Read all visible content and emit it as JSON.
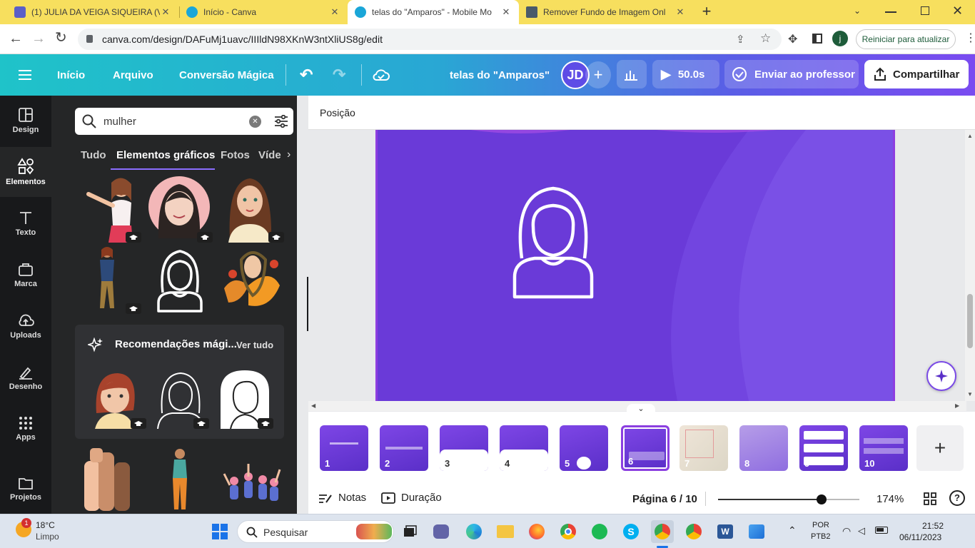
{
  "browser": {
    "tabs": [
      {
        "title": "(1) JULIA DA VEIGA SIQUEIRA (V",
        "icon": "teams-icon"
      },
      {
        "title": "Início - Canva",
        "icon": "canva-icon"
      },
      {
        "title": "telas do \"Amparos\" - Mobile Mo",
        "icon": "canva-icon",
        "active": true
      },
      {
        "title": "Remover Fundo de Imagem Onl",
        "icon": "remove-bg-icon"
      }
    ],
    "url": "canva.com/design/DAFuMj1uavc/IIIldN98XKnW3ntXliUS8g/edit",
    "profile_initial": "j",
    "update_button": "Reiniciar para atualizar"
  },
  "header": {
    "menu_items": [
      "Início",
      "Arquivo",
      "Conversão Mágica"
    ],
    "title": "telas do \"Amparos\"",
    "avatar": "JD",
    "play_time": "50.0s",
    "send_label": "Enviar ao professor",
    "share_label": "Compartilhar"
  },
  "rail": [
    {
      "label": "Design",
      "icon": "design-icon"
    },
    {
      "label": "Elementos",
      "icon": "elements-icon",
      "active": true
    },
    {
      "label": "Texto",
      "icon": "text-icon"
    },
    {
      "label": "Marca",
      "icon": "brand-icon"
    },
    {
      "label": "Uploads",
      "icon": "upload-icon"
    },
    {
      "label": "Desenho",
      "icon": "draw-icon"
    },
    {
      "label": "Apps",
      "icon": "apps-icon"
    },
    {
      "label": "Projetos",
      "icon": "folder-icon"
    }
  ],
  "panel": {
    "search_value": "mulher",
    "tabs": [
      "Tudo",
      "Elementos gráficos",
      "Fotos",
      "Víde"
    ],
    "active_tab": "Elementos gráficos",
    "magic_title": "Recomendações mági...",
    "magic_link": "Ver tudo"
  },
  "editor": {
    "position_label": "Posição",
    "pages": [
      "1",
      "2",
      "3",
      "4",
      "5",
      "6",
      "7",
      "8",
      "9",
      "10"
    ],
    "current_page": 6,
    "notes_label": "Notas",
    "duration_label": "Duração",
    "page_indicator": "Página 6 / 10",
    "zoom": "174%",
    "zoom_level": 0.73
  },
  "taskbar": {
    "temperature": "18°C",
    "weather": "Limpo",
    "weather_badge": "1",
    "search_placeholder": "Pesquisar",
    "lang1": "POR",
    "lang2": "PTB2",
    "time": "21:52",
    "date": "06/11/2023"
  }
}
